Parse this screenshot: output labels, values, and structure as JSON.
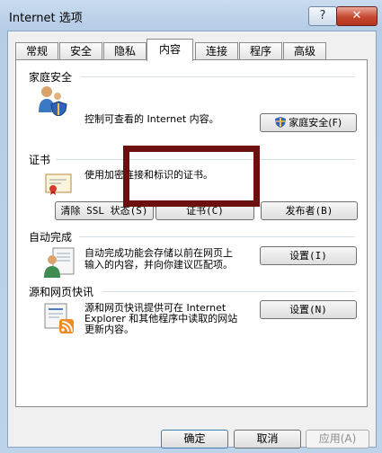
{
  "window": {
    "title": "Internet 选项",
    "help_label": "?",
    "close_label": "✕"
  },
  "tabs": [
    {
      "label": "常规"
    },
    {
      "label": "安全"
    },
    {
      "label": "隐私"
    },
    {
      "label": "内容",
      "active": true
    },
    {
      "label": "连接"
    },
    {
      "label": "程序"
    },
    {
      "label": "高级"
    }
  ],
  "family_safety": {
    "title": "家庭安全",
    "description": "控制可查看的 Internet 内容。",
    "button_label": "家庭安全(F)",
    "icon": "family-safety-icon"
  },
  "certificates": {
    "title": "证书",
    "description": "使用加密连接和标识的证书。",
    "clear_ssl_label": "清除 SSL 状态(S)",
    "certificates_label": "证书(C)",
    "publishers_label": "发布者(B)",
    "icon": "certificate-icon"
  },
  "autocomplete": {
    "title": "自动完成",
    "description_line1": "自动完成功能会存储以前在网页上",
    "description_line2": "输入的内容，并向你建议匹配项。",
    "settings_label": "设置(I)",
    "icon": "autocomplete-icon"
  },
  "feeds": {
    "title": "源和网页快讯",
    "description_line1": "源和网页快讯提供可在 Internet",
    "description_line2": "Explorer 和其他程序中读取的网站",
    "description_line3": "更新内容。",
    "settings_label": "设置(N)",
    "icon": "rss-feed-icon"
  },
  "footer": {
    "ok_label": "确定",
    "cancel_label": "取消",
    "apply_label": "应用(A)"
  },
  "colors": {
    "highlight_box": "#6b0f0f",
    "accent": "#3c7fb1"
  }
}
